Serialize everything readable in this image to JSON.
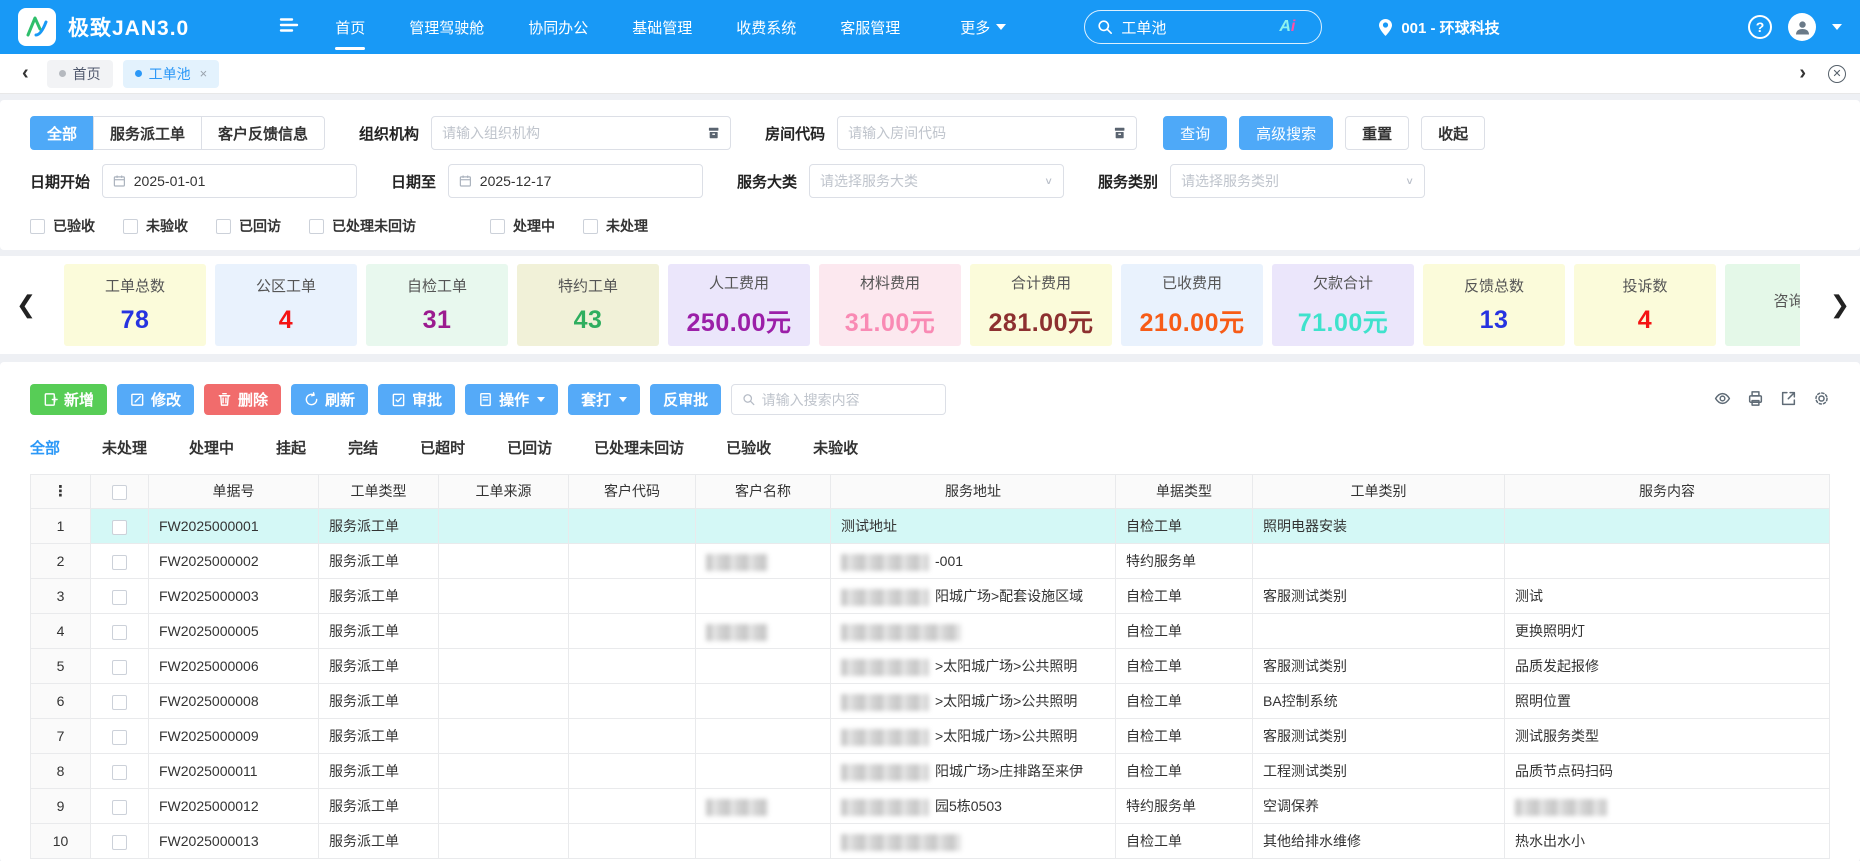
{
  "topbar": {
    "logo_text": "极致JAN3.0",
    "menu": [
      {
        "label": "首页",
        "active": true
      },
      {
        "label": "管理驾驶舱",
        "active": false
      },
      {
        "label": "协同办公",
        "active": false
      },
      {
        "label": "基础管理",
        "active": false
      },
      {
        "label": "收费系统",
        "active": false
      },
      {
        "label": "客服管理",
        "active": false
      }
    ],
    "more_label": "更多",
    "search_value": "工单池",
    "search_badge": "Ai",
    "location": "001 - 环球科技",
    "help_label": "?"
  },
  "tabbar": {
    "tabs": [
      {
        "label": "首页",
        "active": false,
        "closable": false
      },
      {
        "label": "工单池",
        "active": true,
        "closable": true
      }
    ]
  },
  "filters": {
    "type_tabs": [
      {
        "label": "全部",
        "active": true
      },
      {
        "label": "服务派工单",
        "active": false
      },
      {
        "label": "客户反馈信息",
        "active": false
      }
    ],
    "org_label": "组织机构",
    "org_placeholder": "请输入组织机构",
    "room_label": "房间代码",
    "room_placeholder": "请输入房间代码",
    "action_buttons": [
      {
        "label": "查询",
        "style": "primary"
      },
      {
        "label": "高级搜索",
        "style": "primary"
      },
      {
        "label": "重置",
        "style": "default"
      },
      {
        "label": "收起",
        "style": "default"
      }
    ],
    "date_start_label": "日期开始",
    "date_start_value": "2025-01-01",
    "date_end_label": "日期至",
    "date_end_value": "2025-12-17",
    "service_cat_label": "服务大类",
    "service_cat_placeholder": "请选择服务大类",
    "service_type_label": "服务类别",
    "service_type_placeholder": "请选择服务类别",
    "checkboxes": [
      "已验收",
      "未验收",
      "已回访",
      "已处理未回访",
      "处理中",
      "未处理"
    ]
  },
  "stats": {
    "cards": [
      {
        "title": "工单总数",
        "value": "78",
        "bg": "#fbfbda",
        "color": "#2633e0"
      },
      {
        "title": "公区工单",
        "value": "4",
        "bg": "#e9f2fd",
        "color": "#f41313"
      },
      {
        "title": "自检工单",
        "value": "31",
        "bg": "#e8f8ee",
        "color": "#9b1b8f"
      },
      {
        "title": "特约工单",
        "value": "43",
        "bg": "#f1f1d8",
        "color": "#2fae5f"
      },
      {
        "title": "人工费用",
        "value": "250.00元",
        "bg": "#ebe6fb",
        "color": "#9b1fa8"
      },
      {
        "title": "材料费用",
        "value": "31.00元",
        "bg": "#fce8ef",
        "color": "#f98ab4"
      },
      {
        "title": "合计费用",
        "value": "281.00元",
        "bg": "#fbfbda",
        "color": "#8d3030"
      },
      {
        "title": "已收费用",
        "value": "210.00元",
        "bg": "#e9f2fd",
        "color": "#f75c17"
      },
      {
        "title": "欠款合计",
        "value": "71.00元",
        "bg": "#ebe6fb",
        "color": "#3fe2cc"
      },
      {
        "title": "反馈总数",
        "value": "13",
        "bg": "#fbfbda",
        "color": "#2633e0"
      },
      {
        "title": "投诉数",
        "value": "4",
        "bg": "#fbfbda",
        "color": "#f41313"
      },
      {
        "title": "咨询数",
        "value": "",
        "bg": "#e4f8e8",
        "color": "#333333"
      }
    ]
  },
  "toolbar": {
    "buttons": [
      {
        "label": "新增",
        "icon": "add-icon",
        "color": "green",
        "caret": false
      },
      {
        "label": "修改",
        "icon": "edit-icon",
        "color": "blue",
        "caret": false
      },
      {
        "label": "删除",
        "icon": "trash-icon",
        "color": "red",
        "caret": false
      },
      {
        "label": "刷新",
        "icon": "refresh-icon",
        "color": "blue",
        "caret": false
      },
      {
        "label": "审批",
        "icon": "approve-icon",
        "color": "blue",
        "caret": false
      },
      {
        "label": "操作",
        "icon": "doc-icon",
        "color": "blue",
        "caret": true
      },
      {
        "label": "套打",
        "icon": "",
        "color": "blue",
        "caret": true
      },
      {
        "label": "反审批",
        "icon": "",
        "color": "blue",
        "caret": false
      }
    ],
    "search_placeholder": "请输入搜索内容",
    "right_icons": [
      "eye-icon",
      "printer-icon",
      "export-icon",
      "gear-icon"
    ]
  },
  "status_tabs": [
    {
      "label": "全部",
      "active": true
    },
    {
      "label": "未处理",
      "active": false
    },
    {
      "label": "处理中",
      "active": false
    },
    {
      "label": "挂起",
      "active": false
    },
    {
      "label": "完结",
      "active": false
    },
    {
      "label": "已超时",
      "active": false
    },
    {
      "label": "已回访",
      "active": false
    },
    {
      "label": "已处理未回访",
      "active": false
    },
    {
      "label": "已验收",
      "active": false
    },
    {
      "label": "未验收",
      "active": false
    }
  ],
  "table": {
    "columns": [
      "单据号",
      "工单类型",
      "工单来源",
      "客户代码",
      "客户名称",
      "服务地址",
      "单据类型",
      "工单类别",
      "服务内容"
    ],
    "rows": [
      {
        "no": "1",
        "doc_no": "FW2025000001",
        "order_type": "服务派工单",
        "source": "",
        "cust_code": "",
        "cust_blur": false,
        "addr_blur": false,
        "addr": "测试地址",
        "doc_type": "自检工单",
        "category": "照明电器安装",
        "content": "",
        "content_blur": false,
        "highlight": true
      },
      {
        "no": "2",
        "doc_no": "FW2025000002",
        "order_type": "服务派工单",
        "source": "",
        "cust_code": "",
        "cust_blur": true,
        "addr_blur": true,
        "addr": "-001",
        "doc_type": "特约服务单",
        "category": "",
        "content": "",
        "content_blur": false,
        "highlight": false
      },
      {
        "no": "3",
        "doc_no": "FW2025000003",
        "order_type": "服务派工单",
        "source": "",
        "cust_code": "",
        "cust_blur": false,
        "addr_blur": true,
        "addr": "阳城广场>配套设施区域",
        "doc_type": "自检工单",
        "category": "客服测试类别",
        "content": "测试",
        "content_blur": false,
        "highlight": false
      },
      {
        "no": "4",
        "doc_no": "FW2025000005",
        "order_type": "服务派工单",
        "source": "",
        "cust_code": "",
        "cust_blur": true,
        "addr_blur": true,
        "addr": "",
        "doc_type": "自检工单",
        "category": "",
        "content": "更换照明灯",
        "content_blur": false,
        "highlight": false
      },
      {
        "no": "5",
        "doc_no": "FW2025000006",
        "order_type": "服务派工单",
        "source": "",
        "cust_code": "",
        "cust_blur": false,
        "addr_blur": true,
        "addr": ">太阳城广场>公共照明",
        "doc_type": "自检工单",
        "category": "客服测试类别",
        "content": "品质发起报修",
        "content_blur": false,
        "highlight": false
      },
      {
        "no": "6",
        "doc_no": "FW2025000008",
        "order_type": "服务派工单",
        "source": "",
        "cust_code": "",
        "cust_blur": false,
        "addr_blur": true,
        "addr": ">太阳城广场>公共照明",
        "doc_type": "自检工单",
        "category": "BA控制系统",
        "content": "照明位置",
        "content_blur": false,
        "highlight": false
      },
      {
        "no": "7",
        "doc_no": "FW2025000009",
        "order_type": "服务派工单",
        "source": "",
        "cust_code": "",
        "cust_blur": false,
        "addr_blur": true,
        "addr": ">太阳城广场>公共照明",
        "doc_type": "自检工单",
        "category": "客服测试类别",
        "content": "测试服务类型",
        "content_blur": false,
        "highlight": false
      },
      {
        "no": "8",
        "doc_no": "FW2025000011",
        "order_type": "服务派工单",
        "source": "",
        "cust_code": "",
        "cust_blur": false,
        "addr_blur": true,
        "addr": "阳城广场>庄排路至来伊",
        "doc_type": "自检工单",
        "category": "工程测试类别",
        "content": "品质节点码扫码",
        "content_blur": false,
        "highlight": false
      },
      {
        "no": "9",
        "doc_no": "FW2025000012",
        "order_type": "服务派工单",
        "source": "",
        "cust_code": "",
        "cust_blur": true,
        "addr_blur": true,
        "addr": "园5栋0503",
        "doc_type": "特约服务单",
        "category": "空调保养",
        "content": "",
        "content_blur": true,
        "highlight": false
      },
      {
        "no": "10",
        "doc_no": "FW2025000013",
        "order_type": "服务派工单",
        "source": "",
        "cust_code": "",
        "cust_blur": false,
        "addr_blur": true,
        "addr": "",
        "doc_type": "自检工单",
        "category": "其他给排水维修",
        "content": "热水出水小",
        "content_blur": false,
        "highlight": false
      }
    ]
  }
}
